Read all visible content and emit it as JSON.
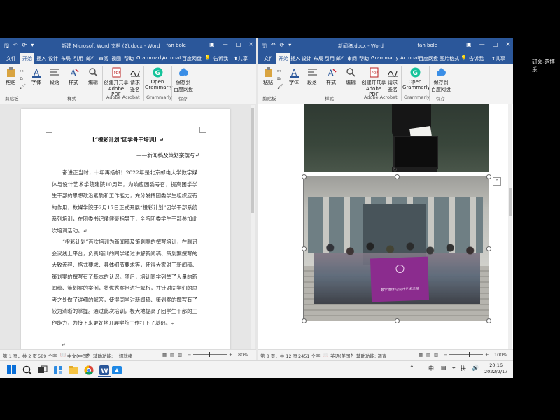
{
  "side_panel": {
    "name": "研会-范博乐"
  },
  "left_window": {
    "title": "新建 Microsoft Word 文档 (2).docx - Word",
    "user": "fan bole",
    "tabs": [
      "文件",
      "开始",
      "插入",
      "设计",
      "布局",
      "引用",
      "邮件",
      "审阅",
      "视图",
      "帮助",
      "Grammarly",
      "Acrobat",
      "百度网盘"
    ],
    "tell_me": "告诉我",
    "share": "共享",
    "ribbon": {
      "paste": "粘贴",
      "font": "字体",
      "paragraph": "段落",
      "styles": "样式",
      "editing": "编辑",
      "create_pdf": "创建并共享",
      "create_pdf2": "Adobe PDF",
      "request_sign": "请求",
      "request_sign2": "签名",
      "open_grammarly": "Open",
      "open_grammarly2": "Grammarly",
      "save_baidu": "保存到",
      "save_baidu2": "百度网盘",
      "group_clipboard": "剪贴板",
      "group_styles": "样式",
      "group_acrobat": "Adobe Acrobat",
      "group_grammarly": "Grammarly",
      "group_save": "保存"
    },
    "document": {
      "title": "【“橙彩计划”团学骨干培训】↵",
      "subtitle": "——新闻稿及策划案撰写↵",
      "paragraph1": "奋进正当时，十年再扬帆！2022年是北京邮电大学数字媒体与设计艺术学院建院10周年，为响应团委号召，提高团学学生干部的思想政治素质和工作能力，充分发挥团委学生组织应有的作用，数媒学院于2月17日正式开展“橙彩计划”团学干部系统系列培训，在团委书记侯健豪指导下，全院团委学生干部参加此次培训活动。↵",
      "paragraph2": "“橙彩计划”首次培训为新闻稿及策划案的撰写培训，在腾讯会议线上平台，负责培训的同学通过讲解新闻稿、策划案撰写的大致流程、格式要求、具体细节要求等，使得大家对于新闻稿、策划案的撰写有了基本的认识。随后，培训同学列举了大量的新闻稿、策划案的案例，将优秀案例进行解析，并针对同学们的思考之处做了详细的解答，使得同学对新闻稿、策划案的撰写有了较为清晰的掌握。通过此次培训，极大地提高了团学生干部的工作能力，为接下来更好地开展学院工作打下了基础。↵",
      "end_mark": "↵"
    },
    "status": {
      "page": "第 1 页，共 2 页",
      "words": "589 个字",
      "lang": "中文(中国)",
      "accessibility": "辅助功能: 一切就绪",
      "zoom": "80%"
    }
  },
  "right_window": {
    "title": "新闻稿.docx - Word",
    "user": "fan bole",
    "tabs": [
      "文件",
      "开始",
      "插入",
      "设计",
      "布局",
      "引用",
      "邮件",
      "审阅",
      "帮助",
      "Grammarly",
      "Acrobat",
      "百度网盘",
      "图片格式"
    ],
    "tell_me": "告诉我",
    "share": "共享",
    "ribbon": {
      "paste": "粘贴",
      "font": "字体",
      "paragraph": "段落",
      "styles": "样式",
      "editing": "编辑",
      "create_pdf": "创建并共享",
      "create_pdf2": "Adobe PDF",
      "request_sign": "请求",
      "request_sign2": "签名",
      "open_grammarly": "Open",
      "open_grammarly2": "Grammarly",
      "save_baidu": "保存到",
      "save_baidu2": "百度网盘",
      "group_clipboard": "剪贴板",
      "group_styles": "样式",
      "group_acrobat": "Adobe Acrobat",
      "group_grammarly": "Grammarly",
      "group_save": "保存"
    },
    "banner_text": "数字媒体与设计艺术学院",
    "status": {
      "page": "第 8 页，共 12 页",
      "words": "2451 个字",
      "lang": "英语(美国)",
      "accessibility": "辅助功能: 调查",
      "zoom": "100%"
    }
  },
  "taskbar": {
    "ime1": "中",
    "ime2": "拼",
    "time": "20:16",
    "date": "2022/2/17"
  },
  "colors": {
    "word_blue": "#2b579a",
    "ribbon_bg": "#f3f3f3",
    "banner_purple": "#8b2c8e"
  }
}
